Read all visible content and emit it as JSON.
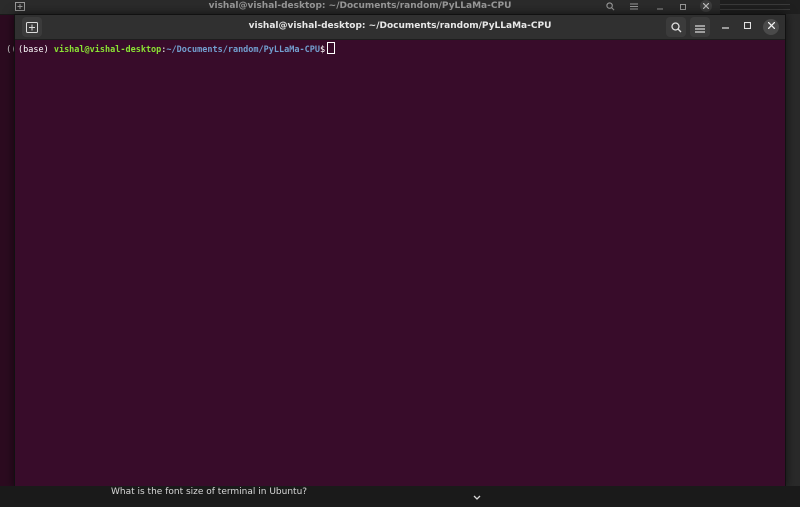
{
  "back_window": {
    "title": "vishal@vishal-desktop: ~/Documents/random/PyLLaMa-CPU",
    "peek_text": "(("
  },
  "front_window": {
    "title": "vishal@vishal-desktop: ~/Documents/random/PyLLaMa-CPU",
    "terminal": {
      "env": "(base) ",
      "user_host": "vishal@vishal-desktop",
      "colon": ":",
      "path": "~/Documents/random/PyLLaMa-CPU",
      "prompt_symbol": "$"
    }
  },
  "caption": {
    "text": "What is the font size of terminal in Ubuntu?"
  },
  "colors": {
    "terminal_bg": "#380c2a",
    "user_green": "#8ae234",
    "path_blue": "#729fcf"
  },
  "icons": [
    "new-tab-icon",
    "search-icon",
    "hamburger-menu-icon",
    "minimize-icon",
    "maximize-icon",
    "close-icon",
    "chevron-down-icon"
  ]
}
